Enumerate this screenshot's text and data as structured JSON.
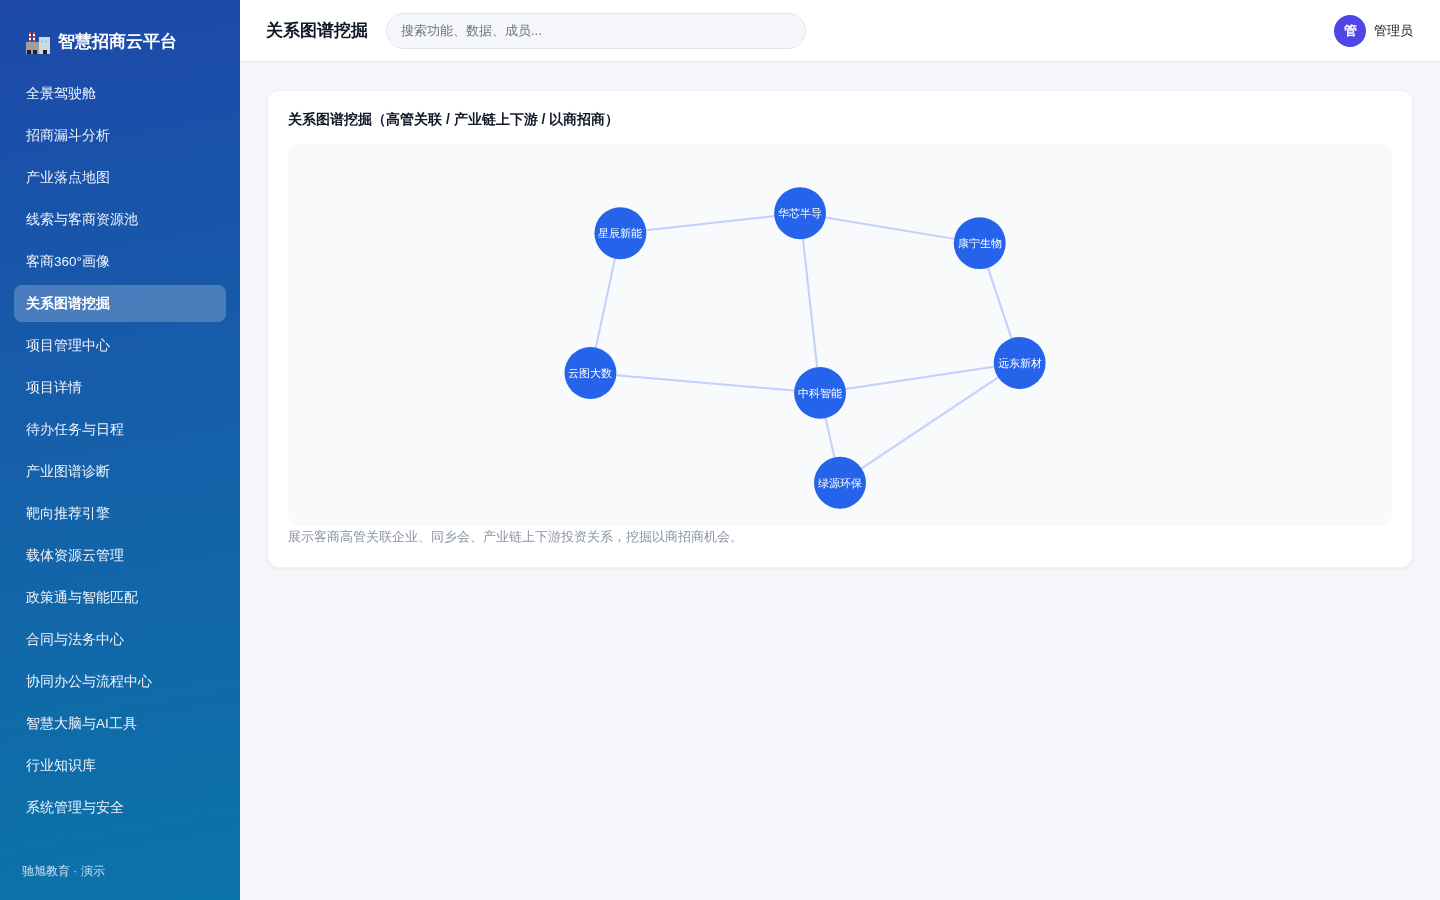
{
  "sidebar": {
    "logo_title": "智慧招商云平台",
    "items": [
      {
        "label": "全景驾驶舱",
        "selected": false
      },
      {
        "label": "招商漏斗分析",
        "selected": false
      },
      {
        "label": "产业落点地图",
        "selected": false
      },
      {
        "label": "线索与客商资源池",
        "selected": false
      },
      {
        "label": "客商360°画像",
        "selected": false
      },
      {
        "label": "关系图谱挖掘",
        "selected": true
      },
      {
        "label": "项目管理中心",
        "selected": false
      },
      {
        "label": "项目详情",
        "selected": false
      },
      {
        "label": "待办任务与日程",
        "selected": false
      },
      {
        "label": "产业图谱诊断",
        "selected": false
      },
      {
        "label": "靶向推荐引擎",
        "selected": false
      },
      {
        "label": "载体资源云管理",
        "selected": false
      },
      {
        "label": "政策通与智能匹配",
        "selected": false
      },
      {
        "label": "合同与法务中心",
        "selected": false
      },
      {
        "label": "协同办公与流程中心",
        "selected": false
      },
      {
        "label": "智慧大脑与AI工具",
        "selected": false
      },
      {
        "label": "行业知识库",
        "selected": false
      },
      {
        "label": "系统管理与安全",
        "selected": false
      }
    ],
    "footer": "驰旭教育 · 演示"
  },
  "header": {
    "title": "关系图谱挖掘",
    "search": {
      "placeholder": "搜索功能、数据、成员..."
    },
    "user": {
      "avatar": "管",
      "name": "管理员"
    }
  },
  "card": {
    "title": "关系图谱挖掘（高管关联 / 产业链上下游 / 以商招商）",
    "graph": {
      "nodes": [
        {
          "label": "星辰新能"
        },
        {
          "label": "华芯半导"
        },
        {
          "label": "康宁生物"
        },
        {
          "label": "云图大数"
        },
        {
          "label": "中科智能"
        },
        {
          "label": "远东新材"
        },
        {
          "label": "绿源环保"
        }
      ]
    },
    "caption": "展示客商高管关联企业、同乡会、产业链上下游投资关系，挖掘以商招商机会。"
  }
}
